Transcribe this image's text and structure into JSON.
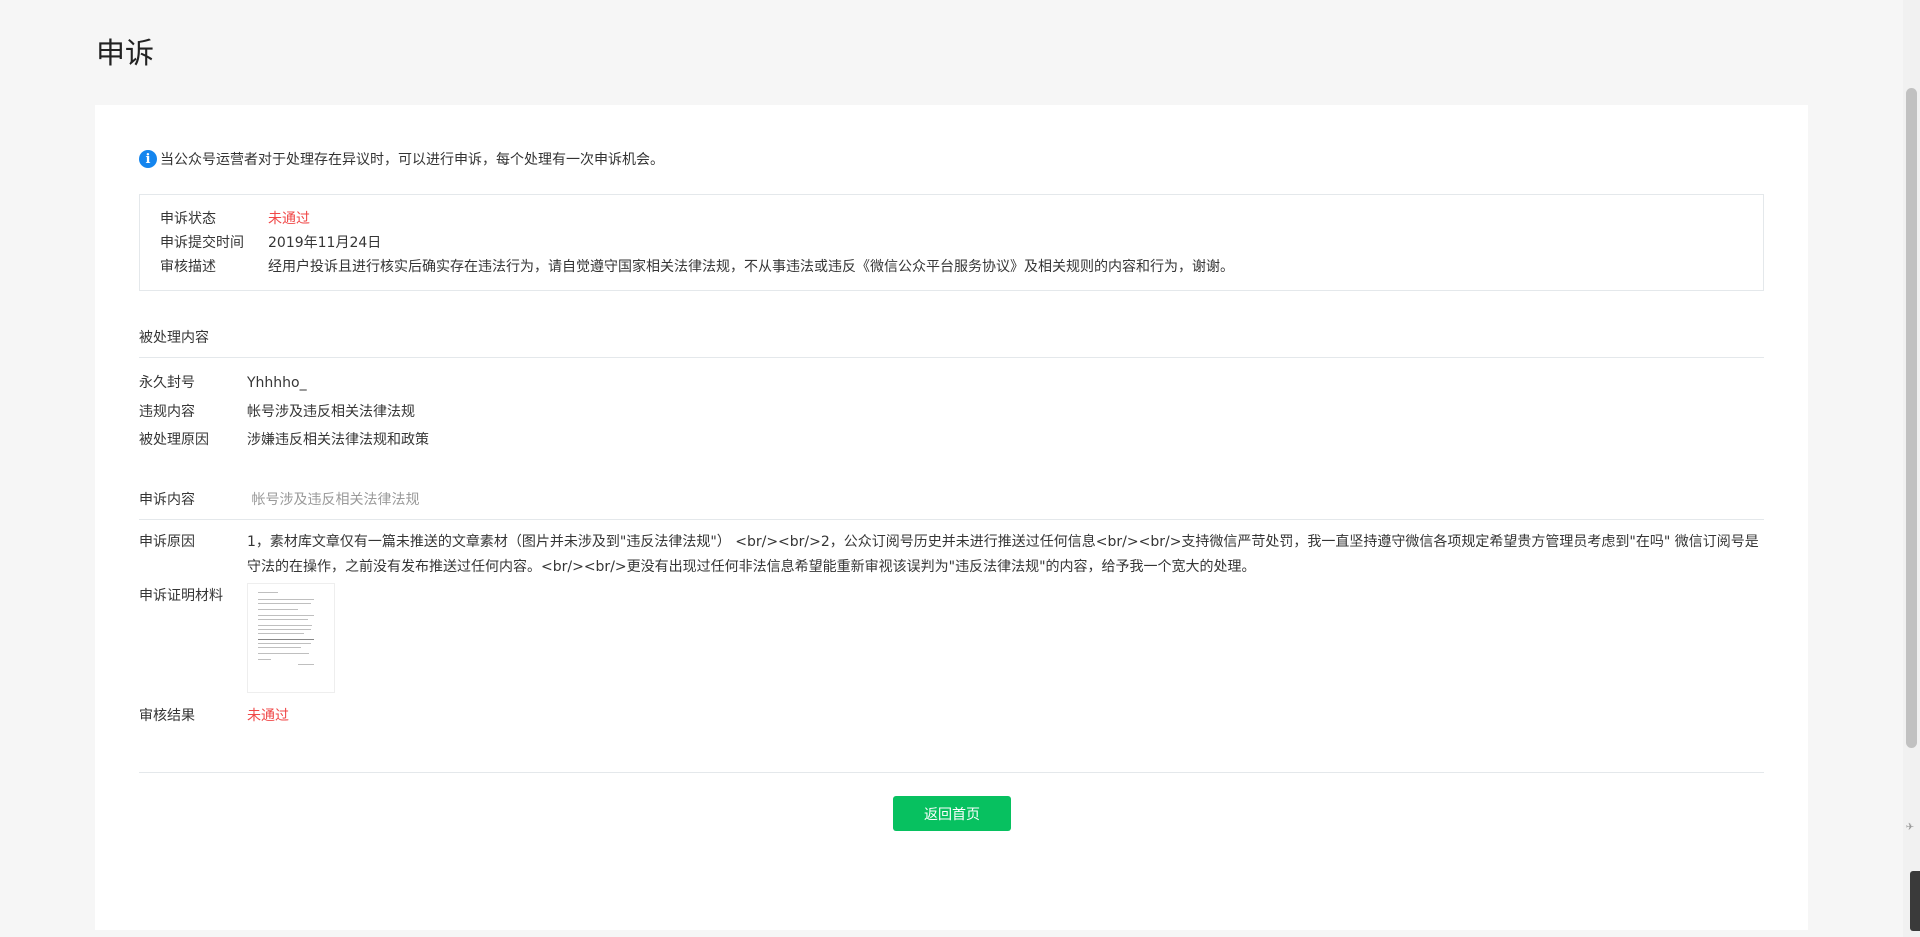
{
  "page": {
    "title": "申诉"
  },
  "notice": {
    "text": "当公众号运营者对于处理存在异议时，可以进行申诉，每个处理有一次申诉机会。"
  },
  "status_box": {
    "rows": [
      {
        "label": "申诉状态",
        "value": "未通过"
      },
      {
        "label": "申诉提交时间",
        "value": "2019年11月24日"
      },
      {
        "label": "审核描述",
        "value": "经用户投诉且进行核实后确实存在违法行为，请自觉遵守国家相关法律法规，不从事违法或违反《微信公众平台服务协议》及相关规则的内容和行为，谢谢。"
      }
    ]
  },
  "processed": {
    "heading": "被处理内容",
    "rows": [
      {
        "label": "永久封号",
        "value": "Yhhhho_"
      },
      {
        "label": "违规内容",
        "value": "帐号涉及违反相关法律法规"
      },
      {
        "label": "被处理原因",
        "value": "涉嫌违反相关法律法规和政策"
      }
    ]
  },
  "appeal": {
    "heading_label": "申诉内容",
    "heading_value": "帐号涉及违反相关法律法规",
    "reason_label": "申诉原因",
    "reason_text": "1，素材库文章仅有一篇未推送的文章素材（图片并未涉及到\"违反法律法规\"） <br/><br/>2，公众订阅号历史并未进行推送过任何信息<br/><br/>支持微信严苛处罚，我一直坚持遵守微信各项规定希望贵方管理员考虑到\"在吗\" 微信订阅号是守法的在操作，之前没有发布推送过任何内容。<br/><br/>更没有出现过任何非法信息希望能重新审视该误判为\"违反法律法规\"的内容，给予我一个宽大的处理。",
    "proof_label": "申诉证明材料",
    "result_label": "审核结果",
    "result_value": "未通过"
  },
  "actions": {
    "home_button": "返回首页"
  },
  "colors": {
    "accent": "#07c160",
    "danger": "#f04848",
    "info": "#1485ee"
  }
}
